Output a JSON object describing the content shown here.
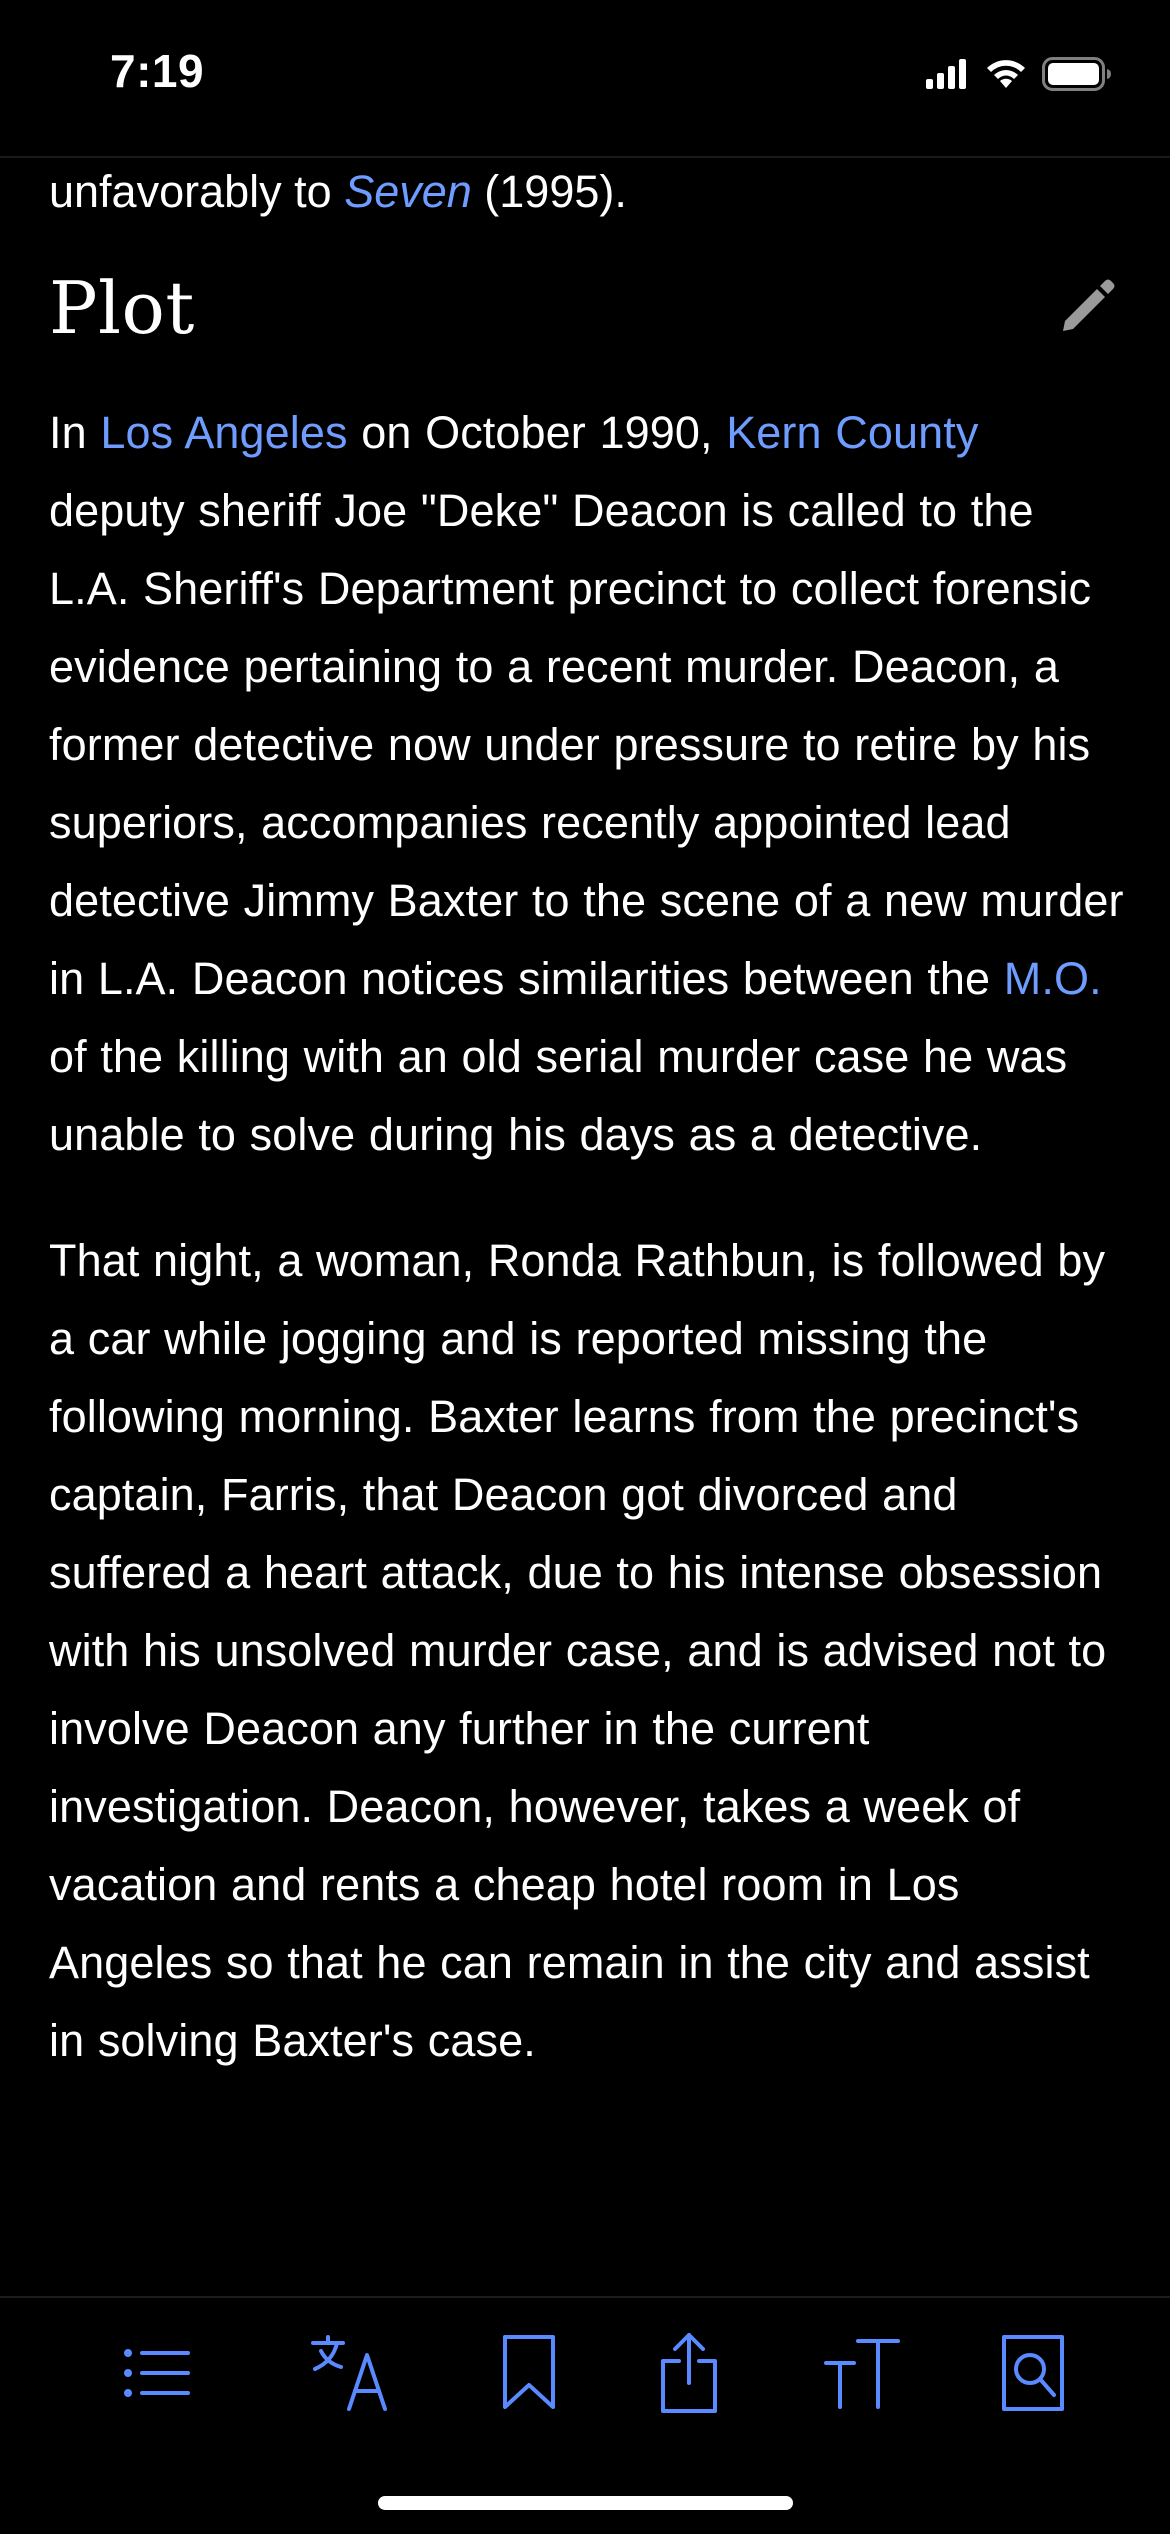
{
  "status_bar": {
    "time": "7:19",
    "icons": [
      "cellular-signal-icon",
      "wifi-icon",
      "battery-icon"
    ]
  },
  "article": {
    "lead_tail": {
      "before": "unfavorably to ",
      "link": "Seven",
      "after": " (1995)."
    },
    "section_title": "Plot",
    "para1": {
      "t1": "In ",
      "l1": "Los Angeles",
      "t2": " on October 1990, ",
      "l2": "Kern County",
      "t3": " deputy sheriff Joe \"Deke\" Deacon is called to the L.A. Sheriff's Department precinct to collect forensic evidence pertaining to a recent murder. Deacon, a former detective now under pressure to retire by his superiors, accompanies recently appointed lead detective Jimmy Baxter to the scene of a new murder in L.A. Deacon notices similarities between the ",
      "l3": "M.O.",
      "t4": " of the killing with an old serial murder case he was unable to solve during his days as a detective."
    },
    "para2": "That night, a woman, Ronda Rathbun, is followed by a car while jogging and is reported missing the following morning. Baxter learns from the precinct's captain, Farris, that Deacon got divorced and suffered a heart attack, due to his intense obsession with his unsolved murder case, and is advised not to involve Deacon any further in the current investigation. Deacon, however, takes a week of vacation and rents a cheap hotel room in Los Angeles so that he can remain in the city and assist in solving Baxter's case."
  },
  "toolbar": {
    "items": [
      "table-of-contents-icon",
      "language-icon",
      "bookmark-icon",
      "share-icon",
      "text-size-icon",
      "find-in-page-icon"
    ]
  },
  "colors": {
    "background": "#000000",
    "text": "#ffffff",
    "link": "#6e9cff",
    "toolbar_icon": "#5a8aff",
    "edit_icon": "#9a9a9a"
  }
}
